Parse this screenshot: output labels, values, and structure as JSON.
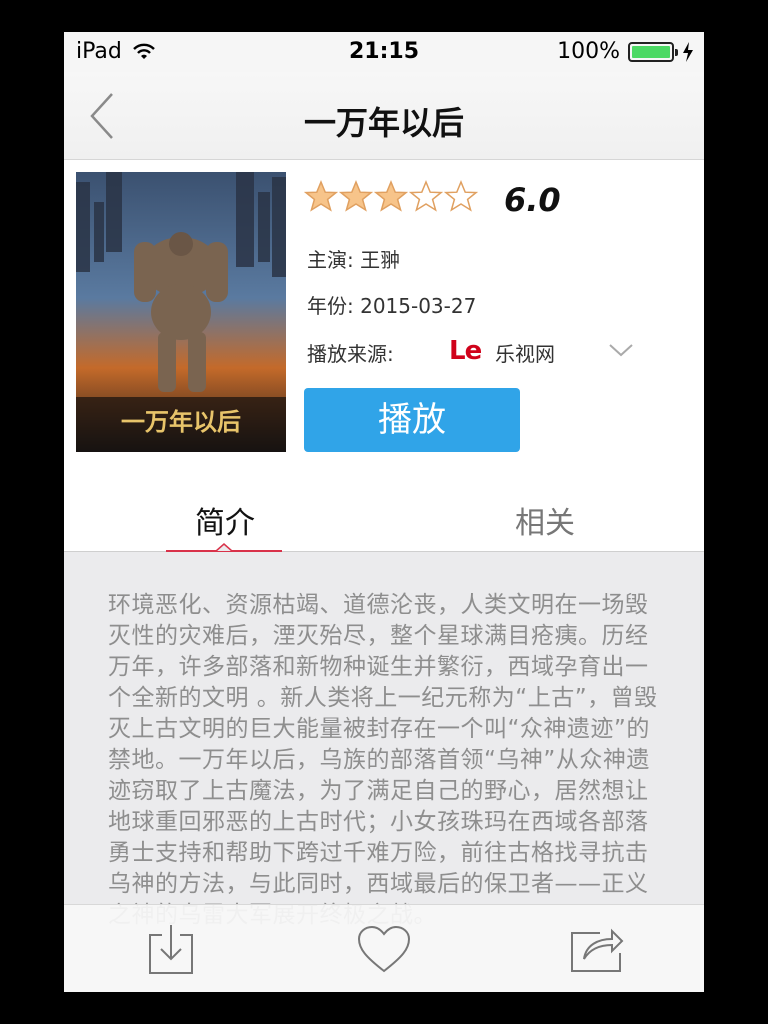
{
  "status_bar": {
    "device": "iPad",
    "time": "21:15",
    "battery_percent": "100%",
    "battery_level": 1.0,
    "wifi_icon": "wifi-icon",
    "charging_icon": "bolt-icon"
  },
  "nav": {
    "title": "一万年以后",
    "back_icon": "chevron-left-icon"
  },
  "movie": {
    "rating_stars": 3,
    "rating_max": 5,
    "score": "6.0",
    "cast": "主演: 王翀",
    "year": "年份: 2015-03-27",
    "source_label": "播放来源:",
    "source_logo": "Le",
    "source_name": "乐视网",
    "play_label": "播放"
  },
  "tabs": [
    {
      "label": "简介",
      "active": true
    },
    {
      "label": "相关",
      "active": false
    }
  ],
  "description": "环境恶化、资源枯竭、道德沦丧，人类文明在一场毁灭性的灾难后，湮灭殆尽，整个星球满目疮痍。历经万年，许多部落和新物种诞生并繁衍，西域孕育出一个全新的文明 。新人类将上一纪元称为“上古”，曾毁灭上古文明的巨大能量被封存在一个叫“众神遗迹”的禁地。一万年以后，乌族的部落首领“乌神”从众神遗迹窃取了上古魔法，为了满足自己的野心，居然想让地球重回邪恶的上古时代；小女孩珠玛在西域各部落勇士支持和帮助下跨过千难万险，前往古格找寻抗击乌神的方法，与此同时，西域最后的保卫者——正义之神的乌雷大军展开终极之战。",
  "colors": {
    "accent_blue": "#30a4e8",
    "tab_indicator": "#d9324a",
    "star_fill": "#f7c48a",
    "star_outline": "#e0a060",
    "battery_green": "#4cd964"
  },
  "toolbar": {
    "download_icon": "download-icon",
    "favorite_icon": "heart-icon",
    "share_icon": "share-icon"
  }
}
